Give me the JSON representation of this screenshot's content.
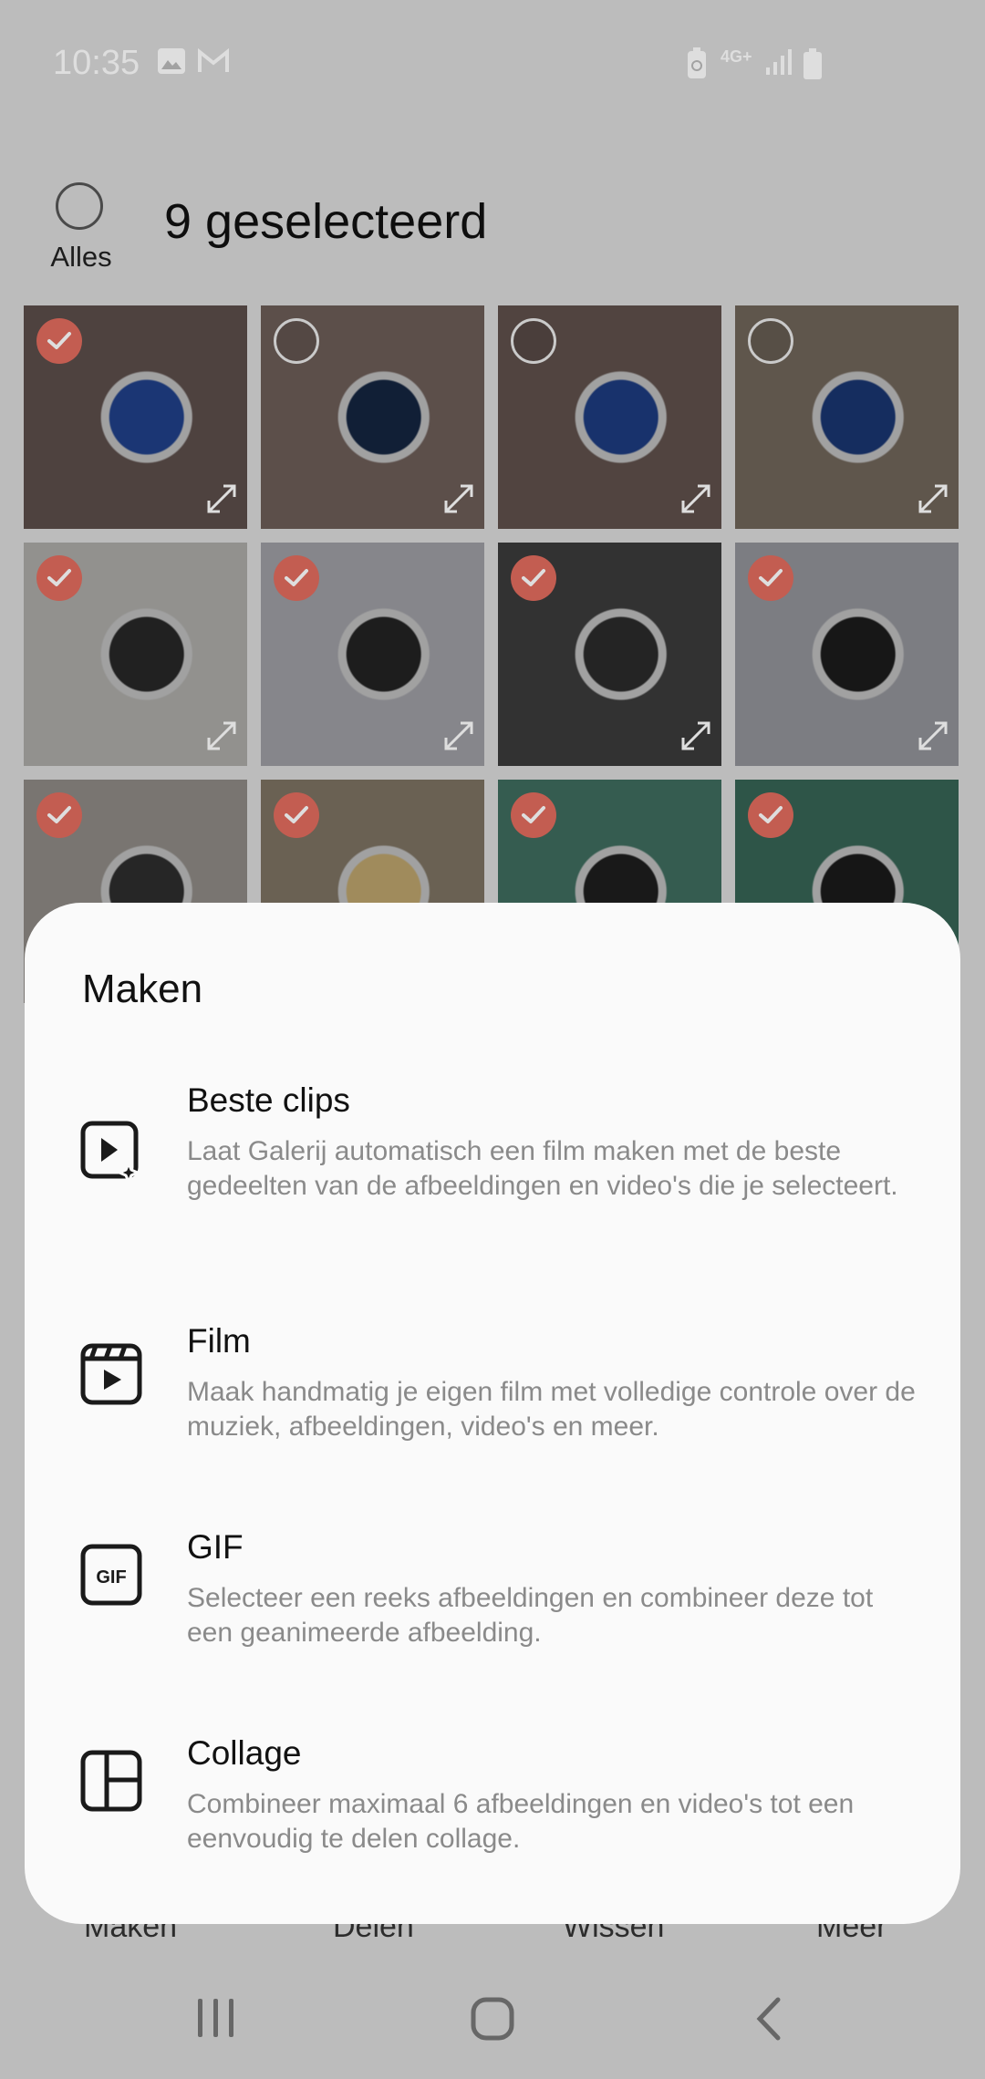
{
  "status_bar": {
    "time": "10:35",
    "network_label": "4G+"
  },
  "header": {
    "select_all_label": "Alles",
    "selection_title": "9 geselecteerd"
  },
  "grid": {
    "tiles": [
      {
        "checked": true,
        "bg": "#5a4c49",
        "accent": "#1f3f86"
      },
      {
        "checked": false,
        "bg": "#6a5b56",
        "accent": "#14243f"
      },
      {
        "checked": false,
        "bg": "#5d4f4a",
        "accent": "#1c3a7c"
      },
      {
        "checked": false,
        "bg": "#6e6358",
        "accent": "#19346e"
      },
      {
        "checked": true,
        "bg": "#a8a7a4",
        "accent": "#262626"
      },
      {
        "checked": true,
        "bg": "#9a9aa0",
        "accent": "#222222"
      },
      {
        "checked": true,
        "bg": "#3a3a3a",
        "accent": "#2a2a2a"
      },
      {
        "checked": true,
        "bg": "#8f9096",
        "accent": "#1b1b1b"
      },
      {
        "checked": true,
        "bg": "#8b8782",
        "accent": "#2c2c2c"
      },
      {
        "checked": true,
        "bg": "#7a7060",
        "accent": "#b8a06a"
      },
      {
        "checked": true,
        "bg": "#3d6a5c",
        "accent": "#1d1d1d"
      },
      {
        "checked": true,
        "bg": "#356253",
        "accent": "#1a1a1a"
      }
    ]
  },
  "bottom_nav": {
    "items": [
      "Maken",
      "Delen",
      "Wissen",
      "Meer"
    ]
  },
  "sheet": {
    "title": "Maken",
    "options": [
      {
        "title": "Beste clips",
        "description": "Laat Galerij automatisch een film maken met de beste gedeelten van de afbeeldingen en video's die je selecteert.",
        "icon": "play-sparkle-icon"
      },
      {
        "title": "Film",
        "description": "Maak handmatig je eigen film met volledige controle over de muziek, afbeeldingen, video's en meer.",
        "icon": "clapperboard-icon"
      },
      {
        "title": "GIF",
        "description": "Selecteer een reeks afbeeldingen en combineer deze tot een geanimeerde afbeelding.",
        "icon": "gif-icon",
        "icon_text": "GIF"
      },
      {
        "title": "Collage",
        "description": "Combineer maximaal 6 afbeeldingen en video's tot een eenvoudig te delen collage.",
        "icon": "collage-icon"
      }
    ]
  },
  "colors": {
    "check_on": "#e06b5d",
    "sheet_bg": "#fafafa"
  }
}
